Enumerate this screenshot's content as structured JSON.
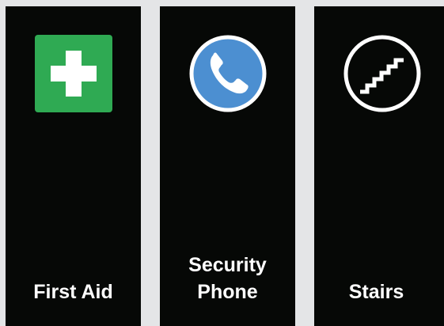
{
  "signs": [
    {
      "label_lines": [
        "First Aid"
      ],
      "icon": "first-aid-cross-icon",
      "icon_color": "#2faa53"
    },
    {
      "label_lines": [
        "Security",
        "Phone"
      ],
      "icon": "telephone-icon",
      "icon_color": "#4c8fd1"
    },
    {
      "label_lines": [
        "Stairs"
      ],
      "icon": "stairs-icon",
      "icon_color": "#060806"
    }
  ],
  "colors": {
    "panel_background": "#060806",
    "page_background": "#e4e5e7",
    "text": "#ffffff"
  }
}
